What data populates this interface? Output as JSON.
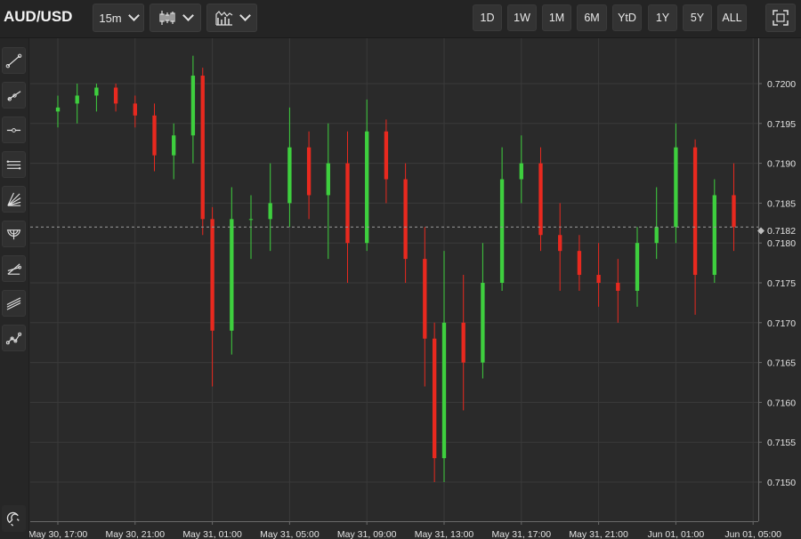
{
  "header": {
    "symbol": "AUD/USD",
    "interval": "15m",
    "chart_style_icon": "candlestick-icon",
    "indicators_icon": "indicators-icon",
    "ranges": [
      "1D",
      "1W",
      "1M",
      "6M",
      "YtD",
      "1Y",
      "5Y",
      "ALL"
    ],
    "fullscreen_icon": "fullscreen-icon"
  },
  "toolbar": {
    "tools": [
      "trend-line-icon",
      "ray-icon",
      "horizontal-line-icon",
      "parallel-channel-icon",
      "fib-fan-icon",
      "fib-arc-icon",
      "pitchfork-icon",
      "parallel-lines-icon",
      "path-icon"
    ],
    "magnet_icon": "magnet-icon"
  },
  "colors": {
    "background": "#2a2a2a",
    "grid": "#3a3a3a",
    "up": "#3ecf3e",
    "down": "#e8291f",
    "price_line": "#9a9a9a"
  },
  "chart_data": {
    "type": "candlestick",
    "symbol": "AUD/USD",
    "interval": "15m",
    "x_ticks": [
      "May 30, 17:00",
      "May 30, 21:00",
      "May 31, 01:00",
      "May 31, 05:00",
      "May 31, 09:00",
      "May 31, 13:00",
      "May 31, 17:00",
      "May 31, 21:00",
      "Jun 01, 01:00",
      "Jun 01, 05:00"
    ],
    "y_ticks": [
      "0.7150",
      "0.7155",
      "0.7160",
      "0.7165",
      "0.7170",
      "0.7175",
      "0.7180",
      "0.7185",
      "0.7190",
      "0.7195",
      "0.7200"
    ],
    "ylim": [
      0.71455,
      0.72065
    ],
    "last_price": "0.7182",
    "grid": true,
    "candle_interval_minutes": 15,
    "candles": [
      [
        "May 30, 17:00",
        0.71965,
        0.71985,
        0.71945,
        0.7197
      ],
      [
        "May 30, 18:00",
        0.71975,
        0.72,
        0.7195,
        0.71985
      ],
      [
        "May 30, 19:00",
        0.71985,
        0.72,
        0.71965,
        0.71995
      ],
      [
        "May 30, 20:00",
        0.71995,
        0.72,
        0.71965,
        0.71975
      ],
      [
        "May 30, 21:00",
        0.71975,
        0.71985,
        0.71945,
        0.7196
      ],
      [
        "May 30, 22:00",
        0.7196,
        0.71975,
        0.7189,
        0.7191
      ],
      [
        "May 30, 23:00",
        0.7191,
        0.7195,
        0.7188,
        0.71935
      ],
      [
        "May 31, 00:00",
        0.71935,
        0.72035,
        0.719,
        0.7201
      ],
      [
        "May 31, 00:30",
        0.7201,
        0.7202,
        0.7181,
        0.7183
      ],
      [
        "May 31, 01:00",
        0.7183,
        0.71845,
        0.7162,
        0.7169
      ],
      [
        "May 31, 02:00",
        0.7169,
        0.7187,
        0.7166,
        0.7183
      ],
      [
        "May 31, 03:00",
        0.7183,
        0.7186,
        0.7178,
        0.7183
      ],
      [
        "May 31, 04:00",
        0.7183,
        0.719,
        0.7179,
        0.7185
      ],
      [
        "May 31, 05:00",
        0.7185,
        0.7197,
        0.7182,
        0.7192
      ],
      [
        "May 31, 06:00",
        0.7192,
        0.7194,
        0.7183,
        0.7186
      ],
      [
        "May 31, 07:00",
        0.7186,
        0.7195,
        0.7178,
        0.719
      ],
      [
        "May 31, 08:00",
        0.719,
        0.7194,
        0.7175,
        0.718
      ],
      [
        "May 31, 09:00",
        0.718,
        0.7198,
        0.7179,
        0.7194
      ],
      [
        "May 31, 10:00",
        0.7194,
        0.71955,
        0.7185,
        0.7188
      ],
      [
        "May 31, 11:00",
        0.7188,
        0.719,
        0.7175,
        0.7178
      ],
      [
        "May 31, 12:00",
        0.7178,
        0.7182,
        0.7162,
        0.7168
      ],
      [
        "May 31, 12:30",
        0.7168,
        0.717,
        0.715,
        0.7153
      ],
      [
        "May 31, 13:00",
        0.7153,
        0.7179,
        0.715,
        0.717
      ],
      [
        "May 31, 14:00",
        0.717,
        0.7176,
        0.7159,
        0.7165
      ],
      [
        "May 31, 15:00",
        0.7165,
        0.718,
        0.7163,
        0.7175
      ],
      [
        "May 31, 16:00",
        0.7175,
        0.7192,
        0.7174,
        0.7188
      ],
      [
        "May 31, 17:00",
        0.7188,
        0.71935,
        0.7185,
        0.719
      ],
      [
        "May 31, 18:00",
        0.719,
        0.7192,
        0.7179,
        0.7181
      ],
      [
        "May 31, 19:00",
        0.7181,
        0.7185,
        0.7174,
        0.7179
      ],
      [
        "May 31, 20:00",
        0.7179,
        0.7181,
        0.7174,
        0.7176
      ],
      [
        "May 31, 21:00",
        0.7176,
        0.718,
        0.7172,
        0.7175
      ],
      [
        "May 31, 22:00",
        0.7175,
        0.7178,
        0.717,
        0.7174
      ],
      [
        "May 31, 23:00",
        0.7174,
        0.7182,
        0.7172,
        0.718
      ],
      [
        "Jun 01, 00:00",
        0.718,
        0.7187,
        0.7178,
        0.7182
      ],
      [
        "Jun 01, 01:00",
        0.7182,
        0.7195,
        0.718,
        0.7192
      ],
      [
        "Jun 01, 02:00",
        0.7192,
        0.7193,
        0.7171,
        0.7176
      ],
      [
        "Jun 01, 03:00",
        0.7176,
        0.7188,
        0.7175,
        0.7186
      ],
      [
        "Jun 01, 04:00",
        0.7186,
        0.719,
        0.7179,
        0.7182
      ]
    ]
  }
}
